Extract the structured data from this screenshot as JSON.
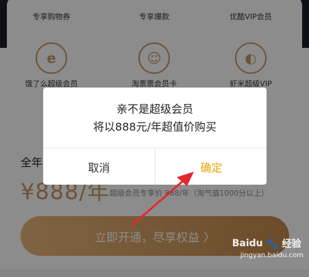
{
  "benefits": {
    "row1": [
      {
        "label": "专享购物券",
        "icon": "coupon-icon"
      },
      {
        "label": "专享爆款",
        "icon": "hot-item-icon"
      },
      {
        "label": "优酷VIP会员",
        "icon": "youku-icon"
      }
    ],
    "row2": [
      {
        "label": "饿了么超级会员",
        "icon": "eleme-icon",
        "glyph": "e"
      },
      {
        "label": "淘票票会员卡",
        "icon": "taopiaopiao-icon",
        "glyph": "☺"
      },
      {
        "label": "虾米超级VIP",
        "icon": "xiami-icon",
        "glyph": "◐"
      }
    ]
  },
  "membership": {
    "year_label": "全年",
    "price": "¥888/年",
    "note": "超级会员专享价 888/年（淘气值1000分以上）",
    "cta_label": "立即开通，尽享权益 〉"
  },
  "dialog": {
    "line1": "亲不是超级会员",
    "line2": "将以888元/年超值价购买",
    "cancel_label": "取消",
    "confirm_label": "确定"
  },
  "watermark": {
    "brand": "Baidu",
    "product": "经验",
    "url": "jingyan.baidu.com"
  },
  "colors": {
    "accent_gold": "#c79a63",
    "confirm_yellow": "#e6a400",
    "annotation_red": "#e0282f"
  }
}
